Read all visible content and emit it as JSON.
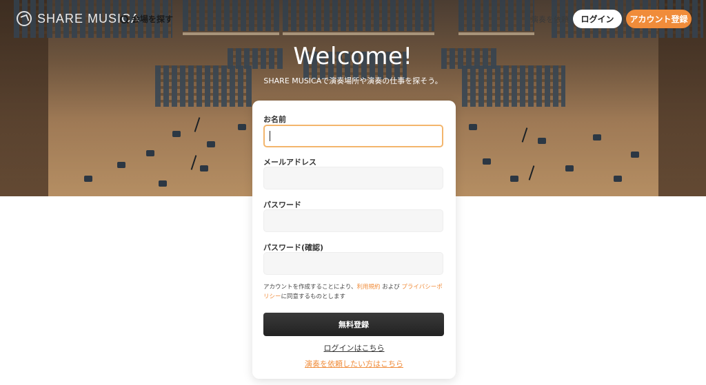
{
  "header": {
    "logo_text": "SHARE MUSICA",
    "search_label": "会場を探す",
    "request_label": "演奏を依頼",
    "login_label": "ログイン",
    "register_label": "アカウント登録"
  },
  "hero": {
    "title": "Welcome!",
    "tagline": "SHARE MUSICAで演奏場所や演奏の仕事を探そう。"
  },
  "form": {
    "name_label": "お名前",
    "name_value": "",
    "email_label": "メールアドレス",
    "email_value": "",
    "password_label": "パスワード",
    "password_value": "",
    "password_confirm_label": "パスワード(確認)",
    "password_confirm_value": "",
    "terms_prefix": "アカウントを作成することにより、",
    "terms_link": "利用規約",
    "terms_middle": " および ",
    "privacy_link": "プライバシーポリシー",
    "terms_suffix": "に同意するものとします",
    "submit_label": "無料登録",
    "login_link": "ログインはこちら",
    "request_link": "演奏を依頼したい方はこちら"
  },
  "colors": {
    "accent": "#f08c3a",
    "submit_bg": "#2b2b2b",
    "focus_border": "#f3b56c"
  }
}
